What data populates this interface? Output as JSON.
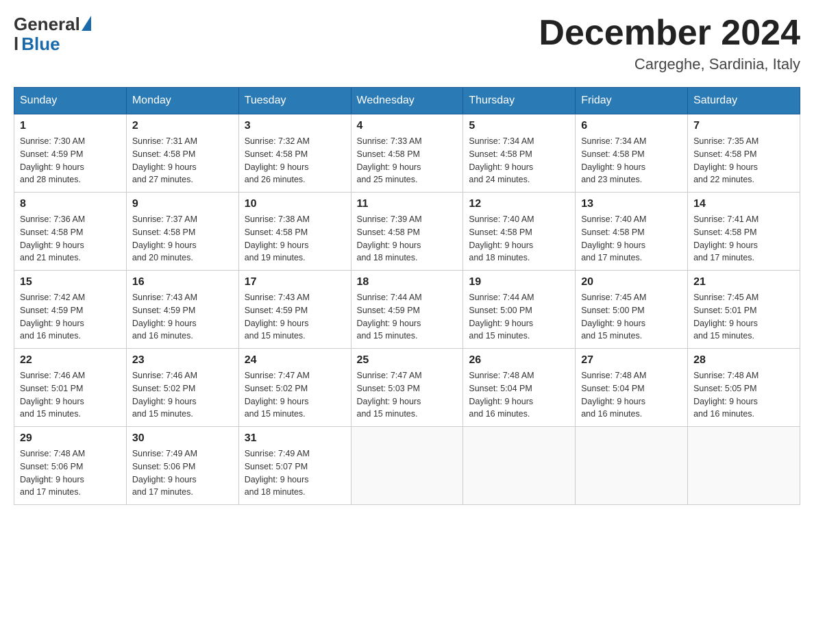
{
  "header": {
    "logo": {
      "general": "General",
      "blue": "Blue"
    },
    "title": "December 2024",
    "location": "Cargeghe, Sardinia, Italy"
  },
  "days_of_week": [
    "Sunday",
    "Monday",
    "Tuesday",
    "Wednesday",
    "Thursday",
    "Friday",
    "Saturday"
  ],
  "weeks": [
    [
      {
        "day": "1",
        "sunrise": "7:30 AM",
        "sunset": "4:59 PM",
        "daylight": "9 hours and 28 minutes."
      },
      {
        "day": "2",
        "sunrise": "7:31 AM",
        "sunset": "4:58 PM",
        "daylight": "9 hours and 27 minutes."
      },
      {
        "day": "3",
        "sunrise": "7:32 AM",
        "sunset": "4:58 PM",
        "daylight": "9 hours and 26 minutes."
      },
      {
        "day": "4",
        "sunrise": "7:33 AM",
        "sunset": "4:58 PM",
        "daylight": "9 hours and 25 minutes."
      },
      {
        "day": "5",
        "sunrise": "7:34 AM",
        "sunset": "4:58 PM",
        "daylight": "9 hours and 24 minutes."
      },
      {
        "day": "6",
        "sunrise": "7:34 AM",
        "sunset": "4:58 PM",
        "daylight": "9 hours and 23 minutes."
      },
      {
        "day": "7",
        "sunrise": "7:35 AM",
        "sunset": "4:58 PM",
        "daylight": "9 hours and 22 minutes."
      }
    ],
    [
      {
        "day": "8",
        "sunrise": "7:36 AM",
        "sunset": "4:58 PM",
        "daylight": "9 hours and 21 minutes."
      },
      {
        "day": "9",
        "sunrise": "7:37 AM",
        "sunset": "4:58 PM",
        "daylight": "9 hours and 20 minutes."
      },
      {
        "day": "10",
        "sunrise": "7:38 AM",
        "sunset": "4:58 PM",
        "daylight": "9 hours and 19 minutes."
      },
      {
        "day": "11",
        "sunrise": "7:39 AM",
        "sunset": "4:58 PM",
        "daylight": "9 hours and 18 minutes."
      },
      {
        "day": "12",
        "sunrise": "7:40 AM",
        "sunset": "4:58 PM",
        "daylight": "9 hours and 18 minutes."
      },
      {
        "day": "13",
        "sunrise": "7:40 AM",
        "sunset": "4:58 PM",
        "daylight": "9 hours and 17 minutes."
      },
      {
        "day": "14",
        "sunrise": "7:41 AM",
        "sunset": "4:58 PM",
        "daylight": "9 hours and 17 minutes."
      }
    ],
    [
      {
        "day": "15",
        "sunrise": "7:42 AM",
        "sunset": "4:59 PM",
        "daylight": "9 hours and 16 minutes."
      },
      {
        "day": "16",
        "sunrise": "7:43 AM",
        "sunset": "4:59 PM",
        "daylight": "9 hours and 16 minutes."
      },
      {
        "day": "17",
        "sunrise": "7:43 AM",
        "sunset": "4:59 PM",
        "daylight": "9 hours and 15 minutes."
      },
      {
        "day": "18",
        "sunrise": "7:44 AM",
        "sunset": "4:59 PM",
        "daylight": "9 hours and 15 minutes."
      },
      {
        "day": "19",
        "sunrise": "7:44 AM",
        "sunset": "5:00 PM",
        "daylight": "9 hours and 15 minutes."
      },
      {
        "day": "20",
        "sunrise": "7:45 AM",
        "sunset": "5:00 PM",
        "daylight": "9 hours and 15 minutes."
      },
      {
        "day": "21",
        "sunrise": "7:45 AM",
        "sunset": "5:01 PM",
        "daylight": "9 hours and 15 minutes."
      }
    ],
    [
      {
        "day": "22",
        "sunrise": "7:46 AM",
        "sunset": "5:01 PM",
        "daylight": "9 hours and 15 minutes."
      },
      {
        "day": "23",
        "sunrise": "7:46 AM",
        "sunset": "5:02 PM",
        "daylight": "9 hours and 15 minutes."
      },
      {
        "day": "24",
        "sunrise": "7:47 AM",
        "sunset": "5:02 PM",
        "daylight": "9 hours and 15 minutes."
      },
      {
        "day": "25",
        "sunrise": "7:47 AM",
        "sunset": "5:03 PM",
        "daylight": "9 hours and 15 minutes."
      },
      {
        "day": "26",
        "sunrise": "7:48 AM",
        "sunset": "5:04 PM",
        "daylight": "9 hours and 16 minutes."
      },
      {
        "day": "27",
        "sunrise": "7:48 AM",
        "sunset": "5:04 PM",
        "daylight": "9 hours and 16 minutes."
      },
      {
        "day": "28",
        "sunrise": "7:48 AM",
        "sunset": "5:05 PM",
        "daylight": "9 hours and 16 minutes."
      }
    ],
    [
      {
        "day": "29",
        "sunrise": "7:48 AM",
        "sunset": "5:06 PM",
        "daylight": "9 hours and 17 minutes."
      },
      {
        "day": "30",
        "sunrise": "7:49 AM",
        "sunset": "5:06 PM",
        "daylight": "9 hours and 17 minutes."
      },
      {
        "day": "31",
        "sunrise": "7:49 AM",
        "sunset": "5:07 PM",
        "daylight": "9 hours and 18 minutes."
      },
      null,
      null,
      null,
      null
    ]
  ],
  "labels": {
    "sunrise": "Sunrise:",
    "sunset": "Sunset:",
    "daylight": "Daylight:"
  }
}
